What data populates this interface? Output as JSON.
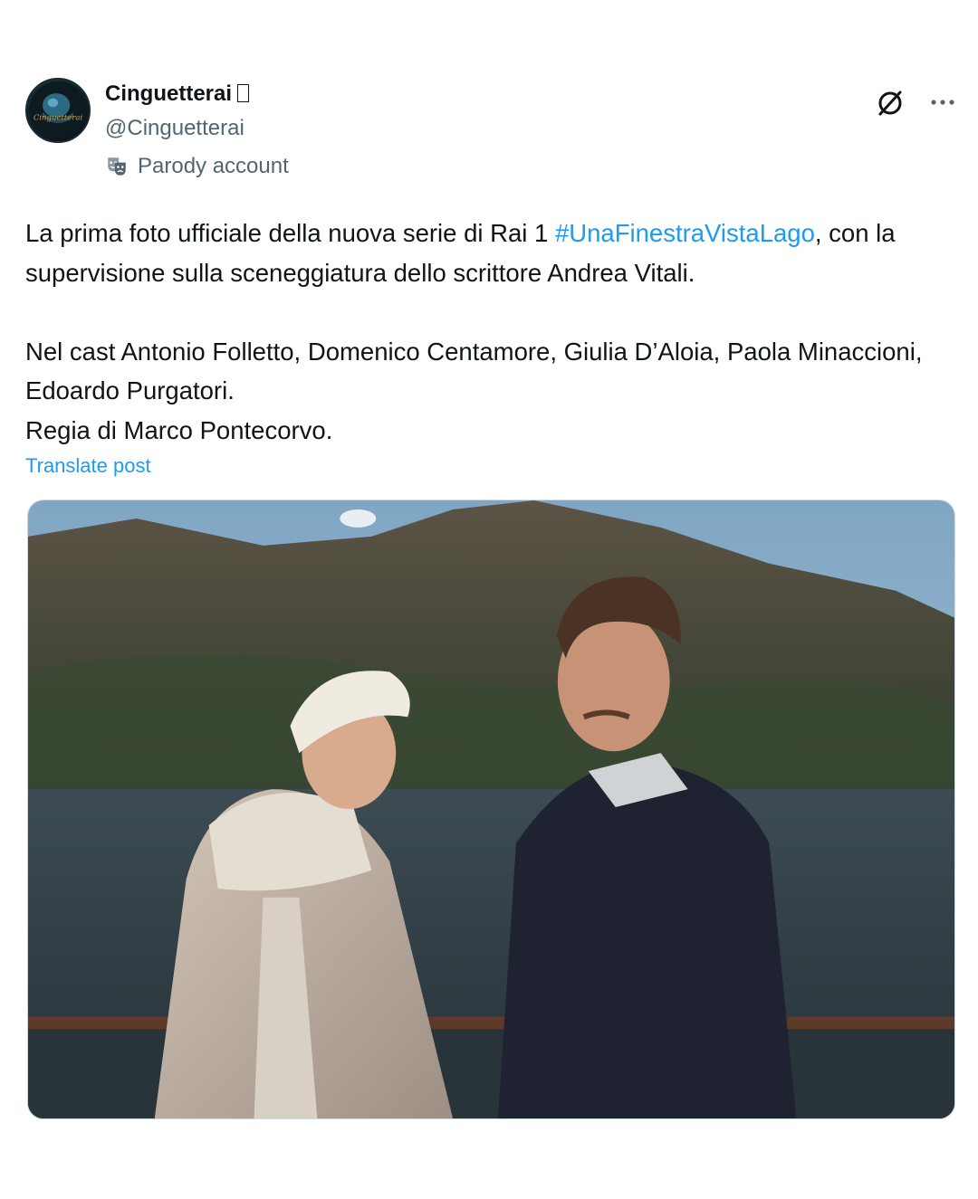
{
  "author": {
    "display_name": "Cinguetterai",
    "handle": "@Cinguetterai",
    "parody_label": "Parody account",
    "avatar_text": "Cinguetterai"
  },
  "post": {
    "text_part1": "La prima foto ufficiale della nuova serie di Rai 1 ",
    "hashtag": "#UnaFinestraVistaLago",
    "text_part2": ", con la supervisione sulla sceneggiatura dello scrittore Andrea Vitali.",
    "cast_line": "Nel cast Antonio Folletto, Domenico Centamore, Giulia D’Aloia, Paola Minaccioni, Edoardo Purgatori.",
    "director_line": "Regia di Marco Pontecorvo.",
    "translate_label": "Translate post"
  },
  "icons": {
    "grok": "grok-icon",
    "more": "more-dots-icon",
    "parody": "theater-mask-icon",
    "verified_box": "badge-placeholder-icon"
  },
  "colors": {
    "text": "#0f1419",
    "secondary": "#536471",
    "link": "#1d9bf0",
    "border": "#cfd9de"
  }
}
